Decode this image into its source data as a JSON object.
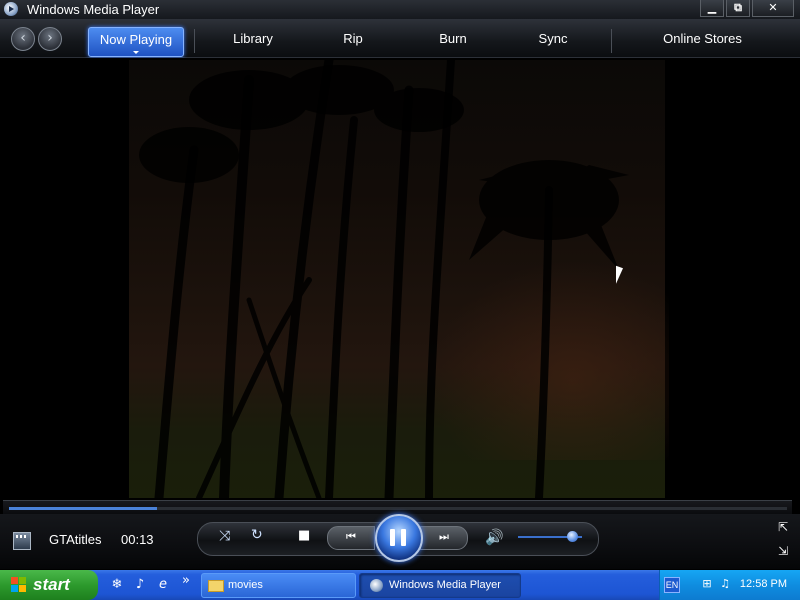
{
  "window": {
    "title": "Windows Media Player",
    "buttons": {
      "minimize": "▁",
      "maximize": "⧉",
      "close": "✕"
    }
  },
  "nav": {
    "back": "‹",
    "forward": "›",
    "tabs": [
      "Now Playing",
      "Library",
      "Rip",
      "Burn",
      "Sync",
      "Online Stores"
    ],
    "active_tab": "Now Playing"
  },
  "now_playing": {
    "clip_name": "GTAtitles",
    "elapsed": "00:13",
    "seek_progress": 0.19,
    "volume_level": 0.85
  },
  "controls": {
    "shuffle_icon": "⤨",
    "repeat_icon": "↻",
    "stop_icon": "■",
    "prev_icon": "⏮",
    "next_icon": "⏭",
    "volume_icon": "🔊"
  },
  "taskbar": {
    "start_label": "start",
    "quicklaunch_overflow": "»",
    "tasks": [
      {
        "label": "movies",
        "state": "inactive"
      },
      {
        "label": "Windows Media Player",
        "state": "active"
      }
    ],
    "tray": {
      "language": "EN",
      "clock": "12:58 PM"
    }
  },
  "colors": {
    "accent": "#1f52c2",
    "taskbar": "#245edc",
    "start": "#2d9a2d",
    "tray": "#0f8de0"
  }
}
